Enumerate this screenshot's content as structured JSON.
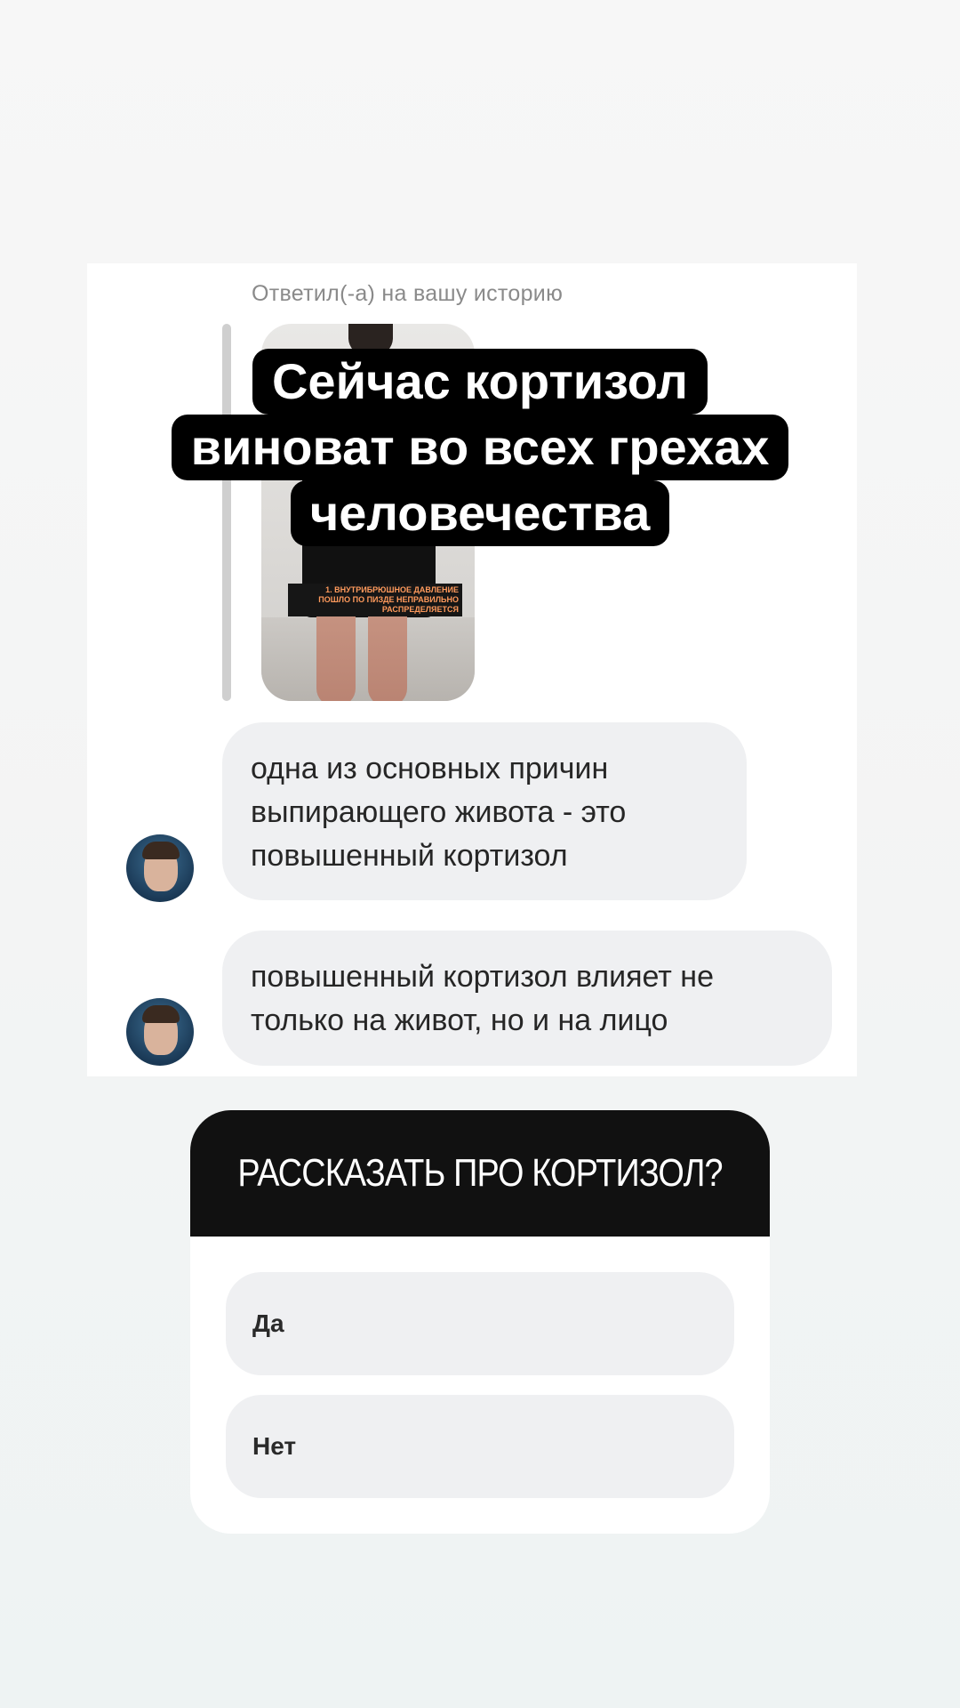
{
  "reply": {
    "caption": "Ответил(-а) на вашу историю",
    "story_caption": "1. Внутрибрюшное давление пошло по пизде неправильно распределяется"
  },
  "headline": {
    "lines": [
      "Сейчас кортизол",
      "виноват во всех грехах",
      "человечества"
    ]
  },
  "messages": [
    {
      "text": "одна из основных причин\nвыпирающего живота  - это\nповышенный кортизол"
    },
    {
      "text": "повышенный кортизол влияет не\nтолько на живот, но и на лицо"
    }
  ],
  "poll": {
    "question": "РАССКАЗАТЬ ПРО КОРТИЗОЛ?",
    "options": [
      {
        "label": "Да"
      },
      {
        "label": "Нет"
      }
    ]
  },
  "colors": {
    "bubble": "#eff0f2",
    "headline_bg": "#000000",
    "poll_header": "#111111"
  }
}
